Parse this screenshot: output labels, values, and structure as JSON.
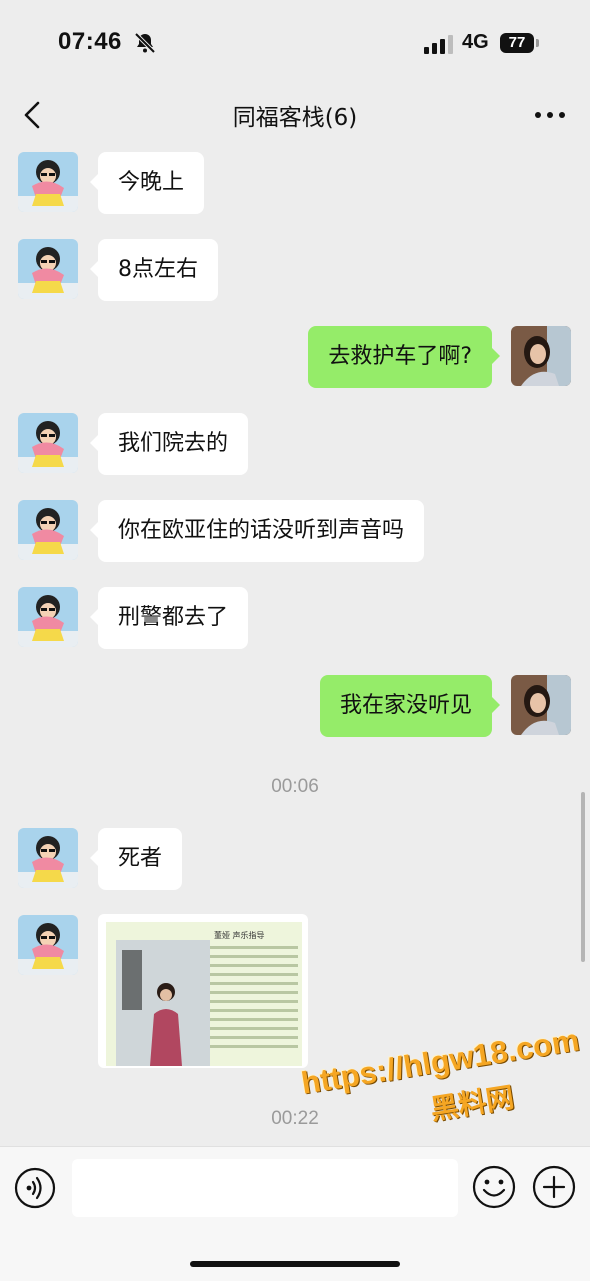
{
  "status_bar": {
    "time": "07:46",
    "network": "4G",
    "battery": "77"
  },
  "nav": {
    "title": "同福客栈(6)"
  },
  "messages": [
    {
      "side": "in",
      "text": "今晚上"
    },
    {
      "side": "in",
      "text": "8点左右"
    },
    {
      "side": "out",
      "text": "去救护车了啊?"
    },
    {
      "side": "in",
      "text": "我们院去的"
    },
    {
      "side": "in",
      "text": "你在欧亚住的话没听到声音吗"
    },
    {
      "side": "in",
      "text": "刑警都去了"
    },
    {
      "side": "out",
      "text": "我在家没听见"
    },
    {
      "side": "in",
      "text": "死者"
    }
  ],
  "timestamps": [
    "00:06",
    "00:22"
  ],
  "image_card": {
    "heading": "董娅   声乐指导"
  },
  "watermark": {
    "url": "https://hlgw18.com",
    "name": "黑料网"
  },
  "colors": {
    "background": "#ededed",
    "outgoing_bubble": "#95ec69",
    "incoming_bubble": "#ffffff"
  }
}
